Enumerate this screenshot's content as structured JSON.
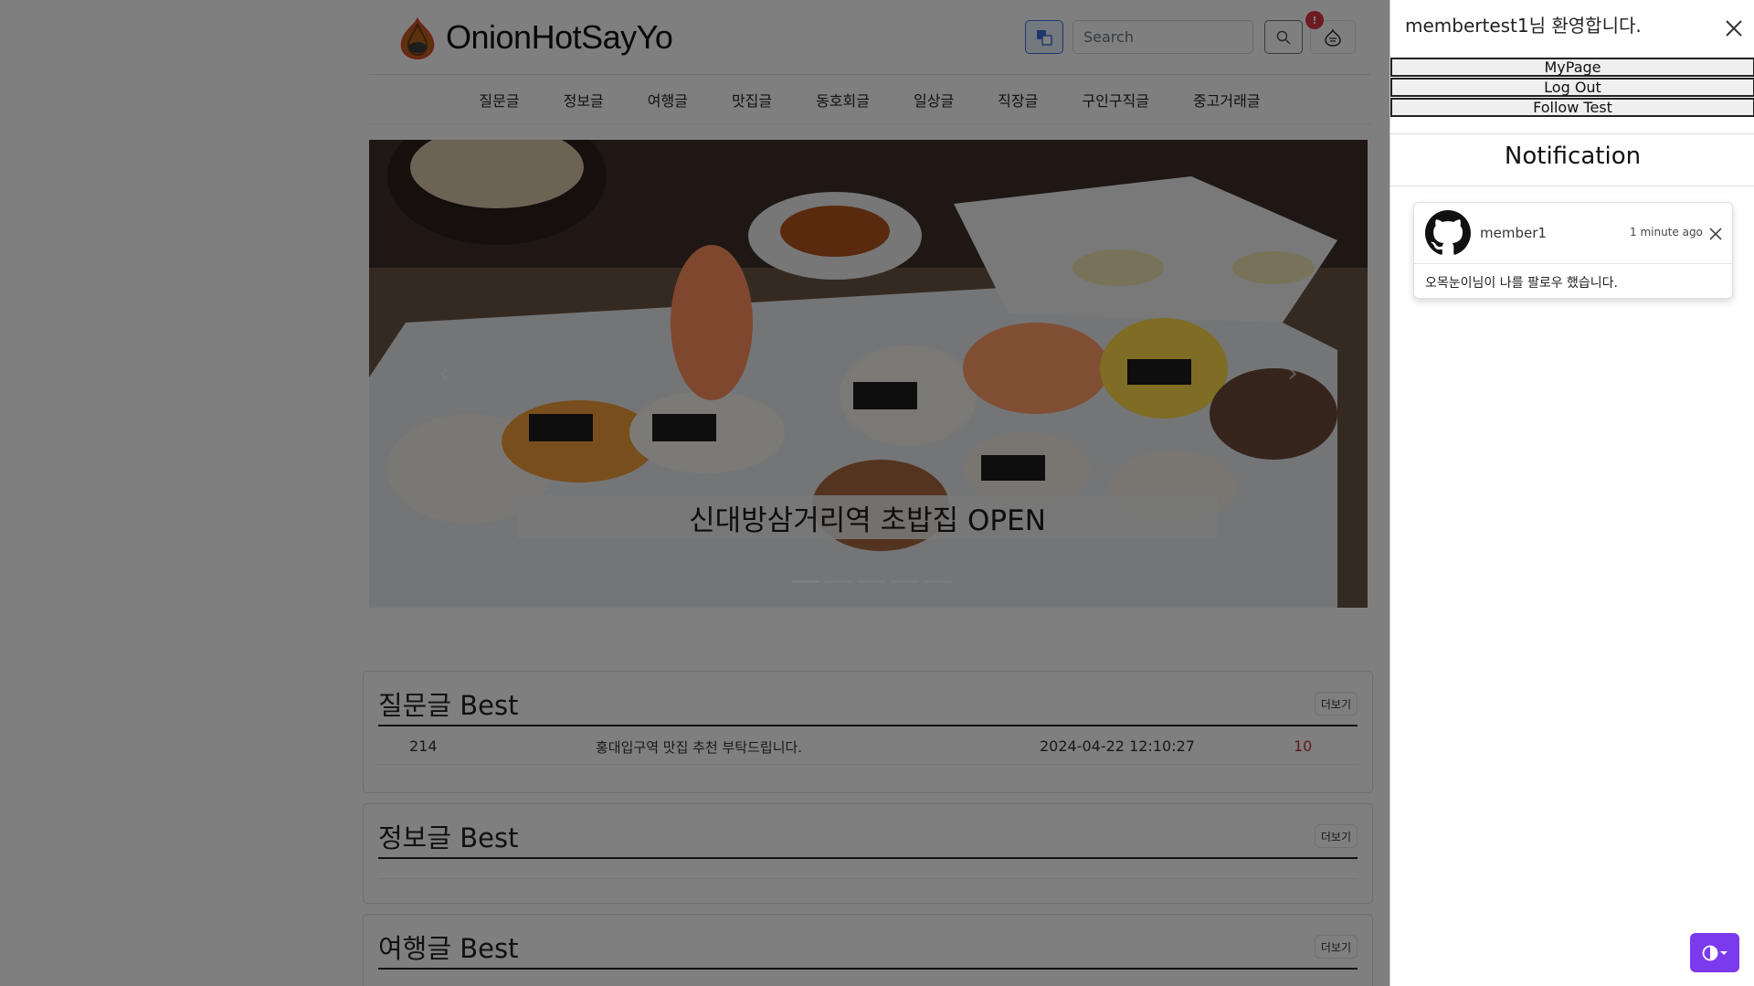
{
  "header": {
    "brand": "OnionHotSayYo",
    "search_placeholder": "Search",
    "notification_badge": "!"
  },
  "nav": {
    "items": [
      "질문글",
      "정보글",
      "여행글",
      "맛집글",
      "동호회글",
      "일상글",
      "직장글",
      "구인구직글",
      "중고거래글"
    ]
  },
  "carousel": {
    "caption": "신대방삼거리역 초밥집 OPEN",
    "prev": "‹",
    "next": "›",
    "slide_count": 5,
    "active_index": 0
  },
  "sections": [
    {
      "title": "질문글 Best",
      "more_label": "더보기",
      "rows": [
        {
          "id": "214",
          "title": "홍대입구역 맛집 추천 부탁드립니다.",
          "date": "2024-04-22 12:10:27",
          "count": "10"
        }
      ]
    },
    {
      "title": "정보글 Best",
      "more_label": "더보기",
      "rows": []
    },
    {
      "title": "여행글 Best",
      "more_label": "더보기",
      "rows": []
    }
  ],
  "offcanvas": {
    "welcome": "membertest1님 환영합니다.",
    "buttons": {
      "mypage": "MyPage",
      "logout": "Log Out",
      "follow_test": "Follow Test"
    },
    "notification_title": "Notification",
    "notification": {
      "user": "member1",
      "time": "1 minute ago",
      "message": "오목눈이님이 나를 팔로우 했습니다."
    }
  },
  "colors": {
    "accent_purple": "#7c3aed",
    "badge_red": "#dc3545",
    "count_red": "#c0392b",
    "lang_blue": "#3d6fd8"
  }
}
